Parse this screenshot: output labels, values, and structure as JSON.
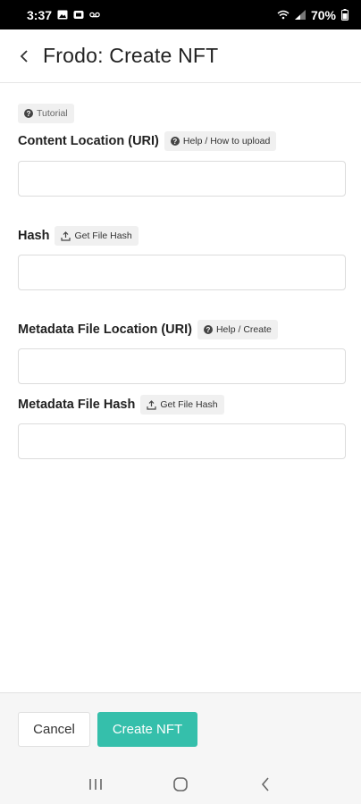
{
  "status_bar": {
    "time": "3:37",
    "battery": "70%",
    "icons": [
      "image-icon",
      "notification-icon",
      "voicemail-icon",
      "wifi-icon",
      "signal-icon",
      "battery-icon"
    ]
  },
  "header": {
    "title": "Frodo: Create NFT",
    "back_icon": "chevron-left-icon"
  },
  "form": {
    "tutorial_label": "Tutorial",
    "fields": [
      {
        "label": "Content Location (URI)",
        "helper": "Help / How to upload",
        "helper_icon": "help-icon",
        "value": ""
      },
      {
        "label": "Hash",
        "helper": "Get File Hash",
        "helper_icon": "upload-icon",
        "value": ""
      },
      {
        "label": "Metadata File Location (URI)",
        "helper": "Help / Create",
        "helper_icon": "help-icon",
        "value": ""
      },
      {
        "label": "Metadata File Hash",
        "helper": "Get File Hash",
        "helper_icon": "upload-icon",
        "value": ""
      }
    ]
  },
  "footer": {
    "cancel_label": "Cancel",
    "create_label": "Create NFT",
    "accent_color": "#35bfab"
  },
  "nav_bar": {
    "icons": [
      "recent-apps-icon",
      "home-icon",
      "back-icon"
    ]
  }
}
